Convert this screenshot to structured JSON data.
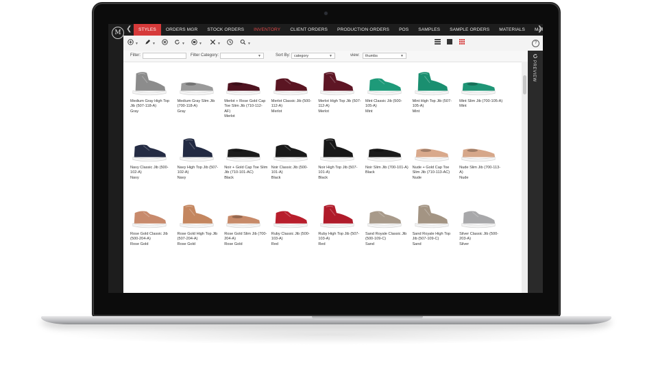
{
  "nav": {
    "logo": "M",
    "prev": "❮",
    "next": "❯",
    "tabs": [
      "STYLES",
      "ORDERS MGR",
      "STOCK ORDERS",
      "INVENTORY",
      "CLIENT ORDERS",
      "PRODUCTION ORDERS",
      "POS",
      "SAMPLES",
      "SAMPLE ORDERS",
      "MATERIALS",
      "MATERIAL MGMT"
    ],
    "active_tab": "STYLES",
    "highlight_tab": "INVENTORY"
  },
  "toolbar": {
    "add_icon": "plus-circle-icon",
    "edit_icon": "pencil-icon",
    "cancel_icon": "x-circle-icon",
    "refresh_icon": "refresh-icon",
    "print_icon": "print-icon",
    "tools_icon": "wrench-icon",
    "history_icon": "clock-icon",
    "search_icon": "search-icon",
    "help": "?",
    "view_modes": [
      "list-view-icon",
      "card-view-icon",
      "thumbs-view-icon"
    ]
  },
  "filters": {
    "filter_label": "Filter:",
    "filter_value": "",
    "filter_category_label": "Filter Category:",
    "filter_category_value": "",
    "sort_label": "Sort By:",
    "sort_value": "category",
    "view_label": "view:",
    "view_value": "thumbs"
  },
  "preview_label": "PREVIEW",
  "colors": {
    "accent": "#d63a3a",
    "nav_bg": "#1d1d1d",
    "gray": "#8a8a8a",
    "merlot": "#5a1522",
    "mint": "#1e9a79",
    "navy": "#22293f",
    "black": "#1a1a1a",
    "nude": "#d9a98c",
    "rose_gold": "#c88a6c",
    "red": "#b81e2c",
    "sand": "#a89a8a",
    "silver": "#a8a8aa"
  },
  "products": [
    {
      "name": "Medium Gray High Top Jib (507-118-A)",
      "color": "Gray",
      "swatch": "#8c8c8c",
      "shape": "high"
    },
    {
      "name": "Medium Gray Slim Jib (700-118-A)",
      "color": "Gray",
      "swatch": "#9a9a9a",
      "shape": "slip"
    },
    {
      "name": "Merlot + Rose Gold Cap Toe Slim Jib (710-112-AF)",
      "color": "Merlot",
      "swatch": "#4f1320",
      "shape": "slip"
    },
    {
      "name": "Merlot Classic Jib (500-112-A)",
      "color": "Merlot",
      "swatch": "#5a1522",
      "shape": "low"
    },
    {
      "name": "Merlot High Top Jib (507-112-A)",
      "color": "Merlot",
      "swatch": "#5e1625",
      "shape": "high"
    },
    {
      "name": "Mint Classic Jib (500-105-A)",
      "color": "Mint",
      "swatch": "#1e9a79",
      "shape": "low"
    },
    {
      "name": "Mint High Top Jib (507-105-A)",
      "color": "Mint",
      "swatch": "#1a8f70",
      "shape": "high"
    },
    {
      "name": "Mint Slim Jib (700-105-A)",
      "color": "Mint",
      "swatch": "#1f9576",
      "shape": "slip"
    },
    {
      "name": "Navy Classic Jib (500-102-A)",
      "color": "Navy",
      "swatch": "#252c44",
      "shape": "low"
    },
    {
      "name": "Navy High Top Jib (507-102-A)",
      "color": "Navy",
      "swatch": "#222a42",
      "shape": "high"
    },
    {
      "name": "Noir + Gold Cap Toe Slim Jib (710-101-AC)",
      "color": "Black",
      "swatch": "#1c1c1c",
      "shape": "slip"
    },
    {
      "name": "Noir Classic Jib (500-101-A)",
      "color": "Black",
      "swatch": "#1a1a1a",
      "shape": "low"
    },
    {
      "name": "Noir High Top Jib (507-101-A)",
      "color": "Black",
      "swatch": "#181818",
      "shape": "high"
    },
    {
      "name": "Noir Slim Jib (700-101-A)",
      "color": "Black",
      "swatch": "#1b1b1b",
      "shape": "slip"
    },
    {
      "name": "Nude + Gold Cap Toe Slim Jib (710-113-AC)",
      "color": "Nude",
      "swatch": "#d9a98c",
      "shape": "slip"
    },
    {
      "name": "Nude Slim Jib (700-113-A)",
      "color": "Nude",
      "swatch": "#d6a78a",
      "shape": "slip"
    },
    {
      "name": "Rose Gold Classic Jib (500-204-A)",
      "color": "Rose Gold",
      "swatch": "#c88a6c",
      "shape": "low"
    },
    {
      "name": "Rose Gold High Top Jib (507-204-A)",
      "color": "Rose Gold",
      "swatch": "#c4865f",
      "shape": "high"
    },
    {
      "name": "Rose Gold Slim Jib (700-204-A)",
      "color": "Rose Gold",
      "swatch": "#c78a69",
      "shape": "slip"
    },
    {
      "name": "Ruby Classic Jib (500-103-A)",
      "color": "Red",
      "swatch": "#b81e2c",
      "shape": "low"
    },
    {
      "name": "Ruby High Top Jib (507-103-A)",
      "color": "Red",
      "swatch": "#b01b2a",
      "shape": "high"
    },
    {
      "name": "Sand Royale Classic Jib (500-109-C)",
      "color": "Sand",
      "swatch": "#a89a8a",
      "shape": "low"
    },
    {
      "name": "Sand Royale High Top Jib (507-109-C)",
      "color": "Sand",
      "swatch": "#a39483",
      "shape": "high"
    },
    {
      "name": "Silver Classic Jib (500-203-A)",
      "color": "Silver",
      "swatch": "#a8a8aa",
      "shape": "low"
    }
  ]
}
